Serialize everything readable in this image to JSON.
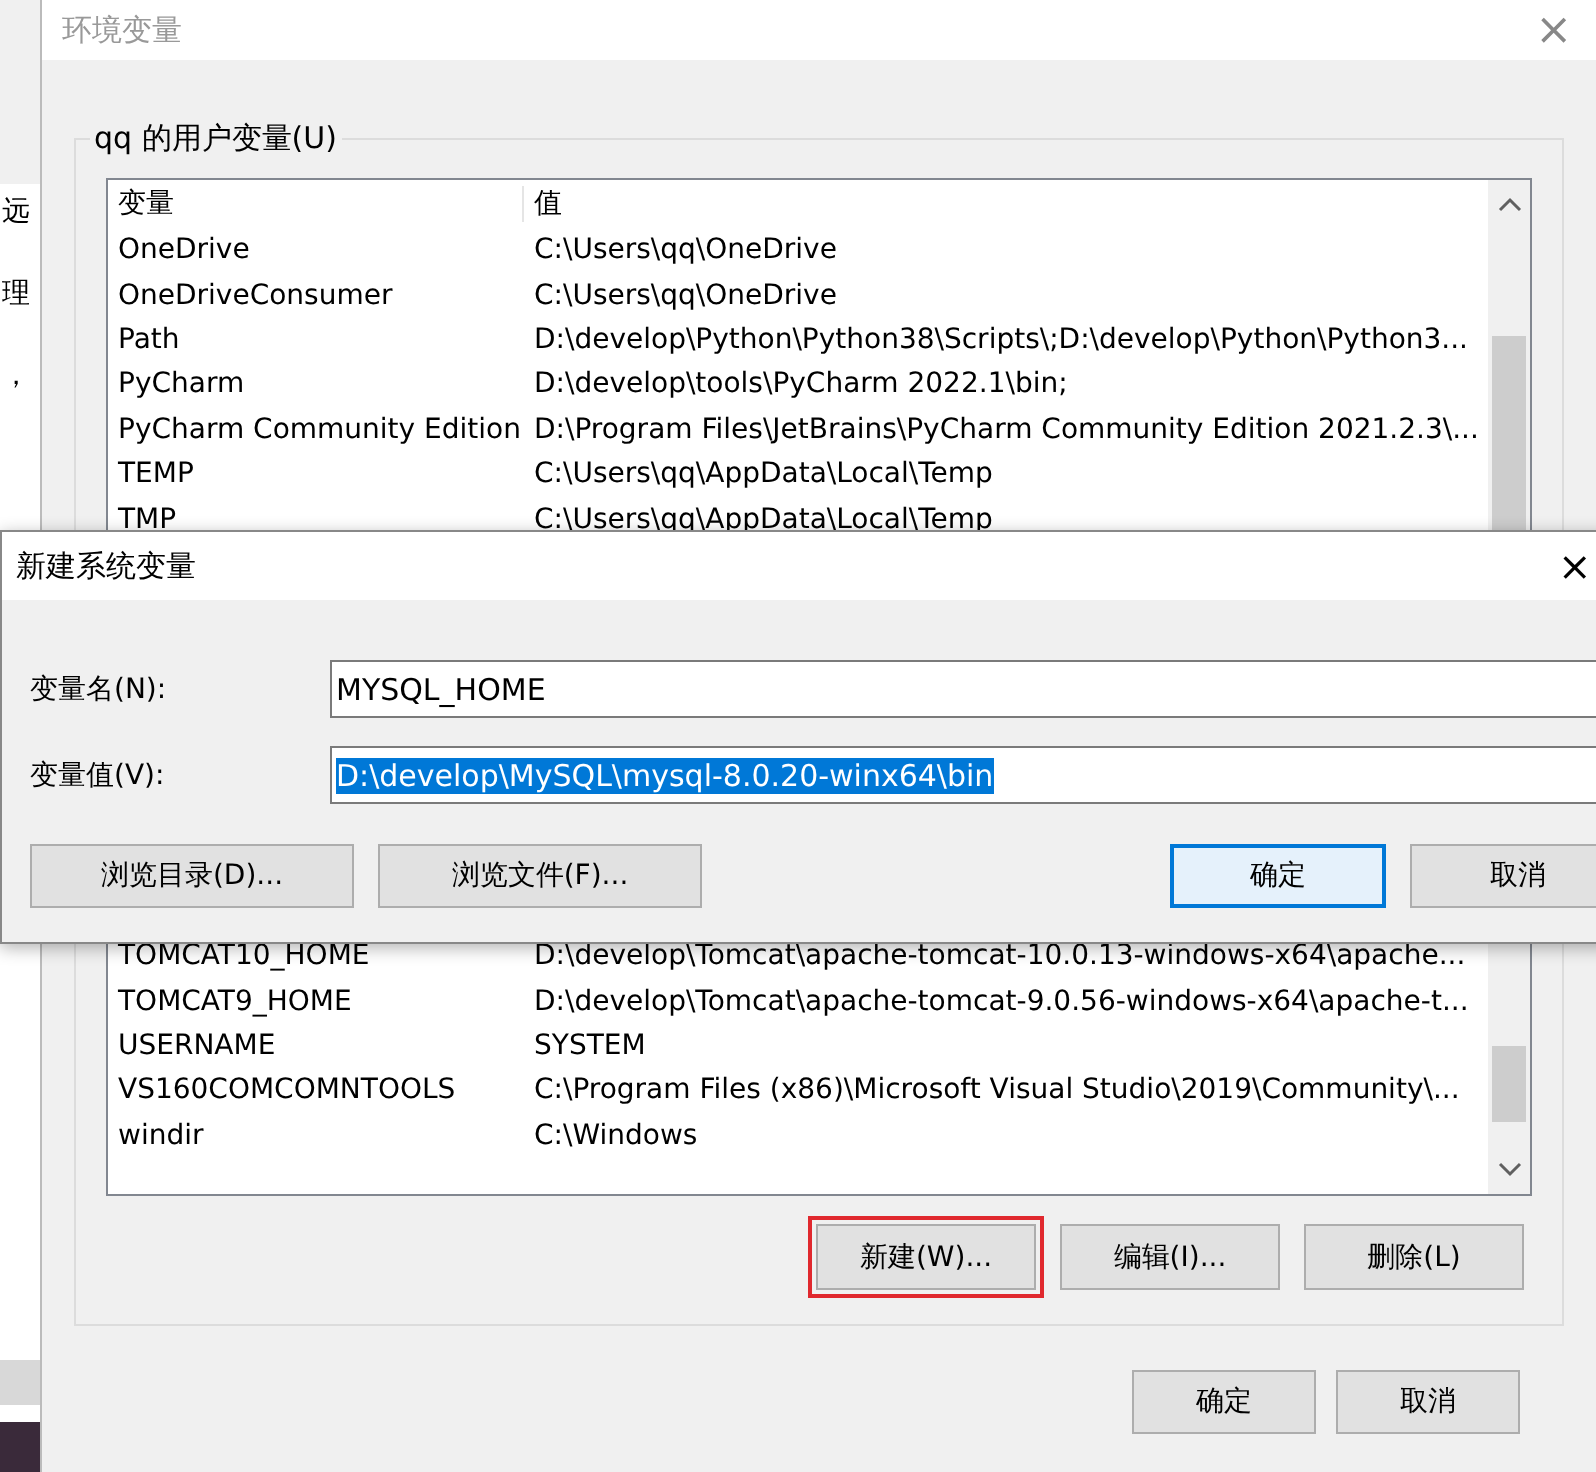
{
  "background_window": {
    "fragments": [
      "远",
      "理",
      "，"
    ]
  },
  "window": {
    "title": "环境变量",
    "close": "×",
    "active": false
  },
  "user_variables": {
    "label": "qq 的用户变量(U)",
    "columns": [
      "变量",
      "值"
    ],
    "rows": [
      {
        "name": "OneDrive",
        "value": "C:\\Users\\qq\\OneDrive"
      },
      {
        "name": "OneDriveConsumer",
        "value": "C:\\Users\\qq\\OneDrive"
      },
      {
        "name": "Path",
        "value": "D:\\develop\\Python\\Python38\\Scripts\\;D:\\develop\\Python\\Python3..."
      },
      {
        "name": "PyCharm",
        "value": "D:\\develop\\tools\\PyCharm 2022.1\\bin;"
      },
      {
        "name": "PyCharm Community Edition",
        "value": "D:\\Program Files\\JetBrains\\PyCharm Community Edition 2021.2.3\\..."
      },
      {
        "name": "TEMP",
        "value": "C:\\Users\\qq\\AppData\\Local\\Temp"
      },
      {
        "name": "TMP",
        "value": "C:\\Users\\qq\\AppData\\Local\\Temp"
      }
    ]
  },
  "system_variables": {
    "rows": [
      {
        "name": "TOMCAT10_HOME",
        "value": "D:\\develop\\Tomcat\\apache-tomcat-10.0.13-windows-x64\\apache..."
      },
      {
        "name": "TOMCAT9_HOME",
        "value": "D:\\develop\\Tomcat\\apache-tomcat-9.0.56-windows-x64\\apache-t..."
      },
      {
        "name": "USERNAME",
        "value": "SYSTEM"
      },
      {
        "name": "VS160COMCOMNTOOLS",
        "value": "C:\\Program Files (x86)\\Microsoft Visual Studio\\2019\\Community\\..."
      },
      {
        "name": "windir",
        "value": "C:\\Windows"
      }
    ],
    "buttons": [
      {
        "label": "新建(W)...",
        "highlighted": true
      },
      {
        "label": "编辑(I)...",
        "highlighted": false
      },
      {
        "label": "删除(L)",
        "highlighted": false
      }
    ]
  },
  "dialog_buttons": [
    {
      "label": "确定",
      "default": false
    },
    {
      "label": "取消",
      "default": false
    }
  ],
  "new_variable_dialog": {
    "title": "新建系统变量",
    "close": "×",
    "fields": [
      {
        "label": "变量名(N):",
        "value": "MYSQL_HOME",
        "selected": false
      },
      {
        "label": "变量值(V):",
        "value": "D:\\develop\\MySQL\\mysql-8.0.20-winx64\\bin",
        "selected": true
      }
    ],
    "left_buttons": [
      "浏览目录(D)...",
      "浏览文件(F)..."
    ],
    "right_buttons": [
      {
        "label": "确定",
        "default": true
      },
      {
        "label": "取消",
        "default": false
      }
    ]
  }
}
